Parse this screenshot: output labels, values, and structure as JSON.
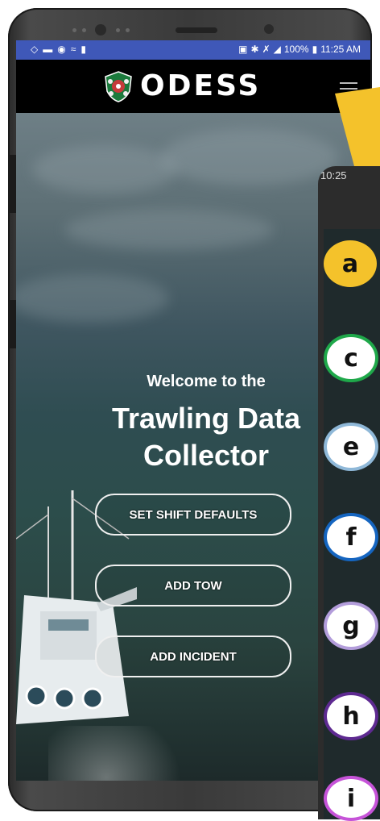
{
  "status_bar": {
    "time": "11:25 AM",
    "battery": "100%"
  },
  "header": {
    "brand": "ODESS"
  },
  "hero": {
    "welcome": "Welcome to the",
    "title_line1": "Trawling Data",
    "title_line2": "Collector"
  },
  "buttons": {
    "set_shift_defaults": "SET SHIFT DEFAULTS",
    "add_tow": "ADD TOW",
    "add_incident": "ADD INCIDENT"
  },
  "overlay": {
    "time": "10:25",
    "badges": [
      "a",
      "c",
      "e",
      "f",
      "g",
      "h",
      "i"
    ]
  },
  "colors": {
    "status_bar": "#3f58b8",
    "header": "#000000",
    "callout_arrow": "#f4c22b",
    "badge_a": "#f4c22b",
    "badge_c": "#1fa84a",
    "badge_e": "#8fb8d8",
    "badge_f": "#1565c0",
    "badge_g": "#b39ddb",
    "badge_h": "#5e2a91",
    "badge_i": "#c653d8"
  }
}
